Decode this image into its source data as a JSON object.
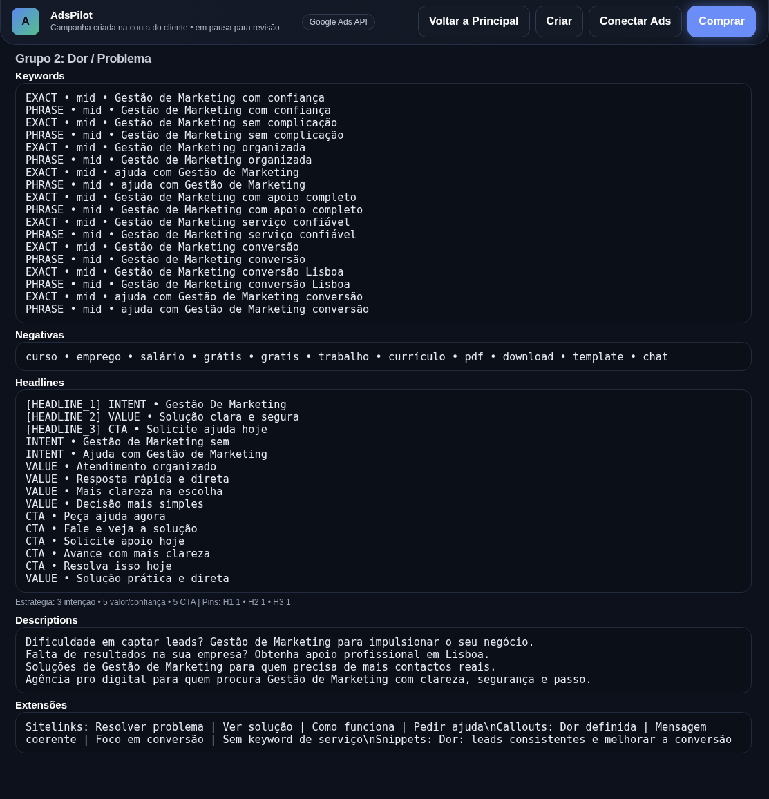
{
  "header": {
    "logo_letter": "A",
    "app_name": "AdsPilot",
    "subtitle": "Campanha criada na conta do cliente • em pausa para revisão",
    "badge": "Google Ads API",
    "buttons": [
      {
        "label": "Voltar a Principal",
        "kind": "secondary"
      },
      {
        "label": "Criar",
        "kind": "secondary"
      },
      {
        "label": "Conectar Ads",
        "kind": "secondary"
      },
      {
        "label": "Comprar",
        "kind": "primary"
      }
    ]
  },
  "group_title": "Grupo 2: Dor / Problema",
  "sections": [
    {
      "title": "Keywords",
      "lines": [
        "EXACT • mid • Gestão de Marketing com confiança",
        "PHRASE • mid • Gestão de Marketing com confiança",
        "EXACT • mid • Gestão de Marketing sem complicação",
        "PHRASE • mid • Gestão de Marketing sem complicação",
        "EXACT • mid • Gestão de Marketing organizada",
        "PHRASE • mid • Gestão de Marketing organizada",
        "EXACT • mid • ajuda com Gestão de Marketing",
        "PHRASE • mid • ajuda com Gestão de Marketing",
        "EXACT • mid • Gestão de Marketing com apoio completo",
        "PHRASE • mid • Gestão de Marketing com apoio completo",
        "EXACT • mid • Gestão de Marketing serviço confiável",
        "PHRASE • mid • Gestão de Marketing serviço confiável",
        "EXACT • mid • Gestão de Marketing conversão",
        "PHRASE • mid • Gestão de Marketing conversão",
        "EXACT • mid • Gestão de Marketing conversão Lisboa",
        "PHRASE • mid • Gestão de Marketing conversão Lisboa",
        "EXACT • mid • ajuda com Gestão de Marketing conversão",
        "PHRASE • mid • ajuda com Gestão de Marketing conversão"
      ]
    },
    {
      "title": "Negativas",
      "lines": [
        "curso • emprego • salário • grátis • gratis • trabalho • currículo • pdf • download • template • chat"
      ]
    },
    {
      "title": "Headlines",
      "lines": [
        "[HEADLINE_1] INTENT • Gestão De Marketing",
        "[HEADLINE_2] VALUE • Solução clara e segura",
        "[HEADLINE_3] CTA • Solicite ajuda hoje",
        "INTENT • Gestão de Marketing sem",
        "INTENT • Ajuda com Gestão de Marketing",
        "VALUE • Atendimento organizado",
        "VALUE • Resposta rápida e direta",
        "VALUE • Mais clareza na escolha",
        "VALUE • Decisão mais simples",
        "CTA • Peça ajuda agora",
        "CTA • Fale e veja a solução",
        "CTA • Solicite apoio hoje",
        "CTA • Avance com mais clareza",
        "CTA • Resolva isso hoje",
        "VALUE • Solução prática e direta"
      ],
      "note": "Estratégia: 3 intenção • 5 valor/confiança • 5 CTA | Pins: H1 1 • H2 1 • H3 1"
    },
    {
      "title": "Descriptions",
      "lines": [
        "Dificuldade em captar leads? Gestão de Marketing para impulsionar o seu negócio.",
        "Falta de resultados na sua empresa? Obtenha apoio profissional em Lisboa.",
        "Soluções de Gestão de Marketing para quem precisa de mais contactos reais.",
        "Agência pro digital para quem procura Gestão de Marketing com clareza, segurança e passo."
      ]
    },
    {
      "title": "Extensões",
      "lines": [
        "Sitelinks: Resolver problema | Ver solução | Como funciona | Pedir ajuda\\nCallouts: Dor definida | Mensagem coerente | Foco em conversão | Sem keyword de serviço\\nSnippets: Dor: leads consistentes e melhorar a conversão"
      ]
    }
  ]
}
